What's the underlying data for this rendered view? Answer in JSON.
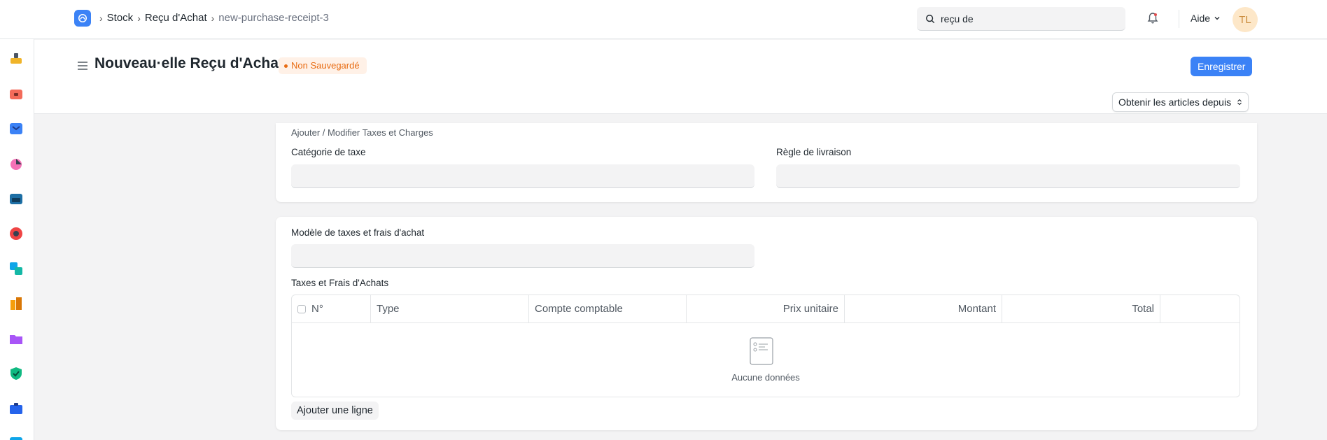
{
  "navbar": {
    "breadcrumbs": [
      "Stock",
      "Reçu d'Achat",
      "new-purchase-receipt-3"
    ],
    "search_value": "reçu de",
    "help_label": "Aide",
    "avatar_initials": "TL"
  },
  "page": {
    "title": "Nouveau·elle Reçu d'Achat",
    "status_badge": "Non Sauvegardé",
    "save_button": "Enregistrer",
    "get_items_button": "Obtenir les articles depuis"
  },
  "taxes_section": {
    "title": "Ajouter / Modifier Taxes et Charges",
    "tax_category_label": "Catégorie de taxe",
    "tax_category_value": "",
    "shipping_rule_label": "Règle de livraison",
    "shipping_rule_value": ""
  },
  "template_section": {
    "template_label": "Modèle de taxes et frais d'achat",
    "template_value": "",
    "table_label": "Taxes et Frais d'Achats",
    "columns": [
      "N°",
      "Type",
      "Compte comptable",
      "Prix unitaire",
      "Montant",
      "Total"
    ],
    "empty_text": "Aucune données",
    "add_row_button": "Ajouter une ligne"
  },
  "colors": {
    "primary": "#3b82f6",
    "warning": "#e86c13"
  },
  "sidebar_icons": [
    "buying-icon",
    "selling-icon",
    "stock-icon",
    "accounting-icon",
    "assets-icon",
    "crm-icon",
    "manufacturing-icon",
    "projects-icon",
    "quality-icon",
    "support-icon",
    "hr-icon",
    "tools-icon"
  ]
}
